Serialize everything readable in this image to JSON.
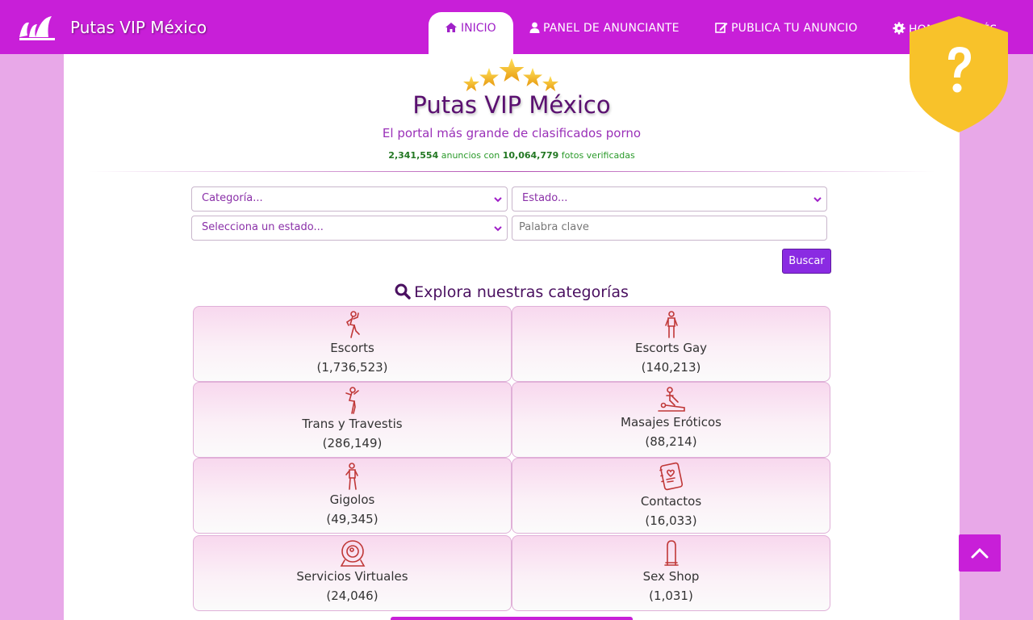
{
  "brand": "Putas VIP México",
  "nav": {
    "items": [
      {
        "label": "INICIO",
        "icon": "home-icon",
        "active": true
      },
      {
        "label": "PANEL DE ANUNCIANTE",
        "icon": "user-icon"
      },
      {
        "label": "PUBLICA TU ANUNCIO",
        "icon": "edit-icon"
      },
      {
        "label": "HOMBRE / IRÉS",
        "icon": "gear-icon"
      }
    ]
  },
  "hero": {
    "title": "Putas VIP México",
    "tagline": "El portal más grande de clasificados porno",
    "ads_count": "2,341,554",
    "ads_label": "anuncios con",
    "photos_count": "10,064,779",
    "photos_label": "fotos verificadas"
  },
  "search": {
    "category": "Categoría...",
    "state": "Estado...",
    "state_select": "Selecciona un estado...",
    "keyword_placeholder": "Palabra clave",
    "button": "Buscar"
  },
  "categories_heading": "Explora nuestras categorías",
  "categories": [
    {
      "name": "Escorts",
      "count": "(1,736,523)",
      "icon": "escort-icon"
    },
    {
      "name": "Escorts Gay",
      "count": "(140,213)",
      "icon": "gay-escort-icon"
    },
    {
      "name": "Trans y Travestis",
      "count": "(286,149)",
      "icon": "trans-icon"
    },
    {
      "name": "Masajes Eróticos",
      "count": "(88,214)",
      "icon": "massage-icon"
    },
    {
      "name": "Gigolos",
      "count": "(49,345)",
      "icon": "gigolo-icon"
    },
    {
      "name": "Contactos",
      "count": "(16,033)",
      "icon": "contacts-book-icon"
    },
    {
      "name": "Servicios Virtuales",
      "count": "(24,046)",
      "icon": "webcam-icon"
    },
    {
      "name": "Sex Shop",
      "count": "(1,031)",
      "icon": "condom-icon"
    }
  ],
  "colors": {
    "nav_bg": "#c81fd8",
    "page_bg": "#e8a8e8",
    "accent_purple": "#8a2be2",
    "stats_green": "#2a9a2a",
    "shield_yellow": "#f8c22a"
  }
}
